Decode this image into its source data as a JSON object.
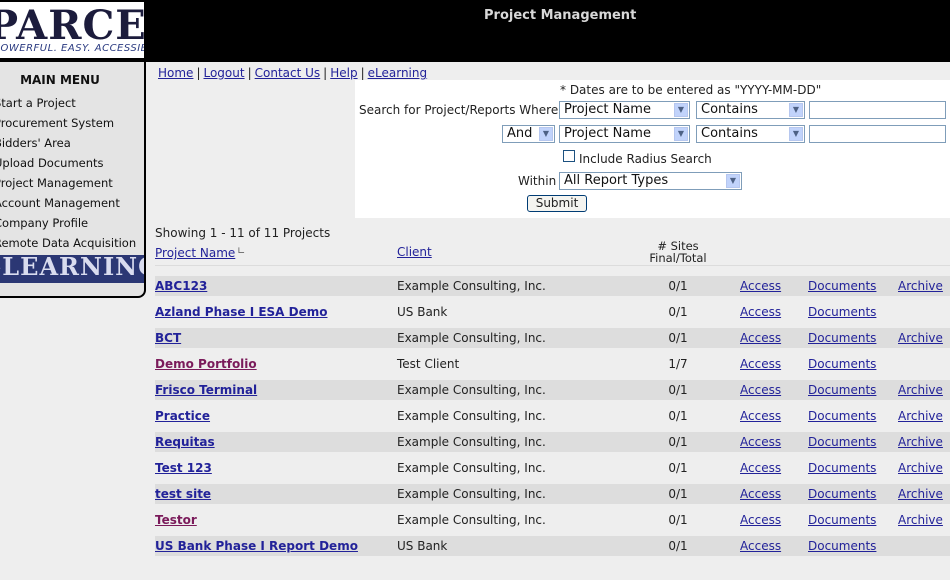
{
  "header": {
    "logo_text": "PARCEL",
    "logo_tagline": "POWERFUL. EASY. ACCESSIBLE.",
    "page_title": "Project Management"
  },
  "sidebar": {
    "title": "MAIN MENU",
    "items": [
      "Start a Project",
      "Procurement System",
      "Bidders' Area",
      "Upload Documents",
      "Project Management",
      "Account Management",
      "Company Profile",
      "Remote Data Acquisition"
    ],
    "banner": "eLEARNING"
  },
  "toplinks": [
    "Home",
    "Logout",
    "Contact Us",
    "Help",
    "eLearning"
  ],
  "search": {
    "date_note": "* Dates are to be entered as \"YYYY-MM-DD\"",
    "label_where": "Search for Project/Reports Where",
    "row1": {
      "field": "Project Name",
      "operator": "Contains",
      "value": ""
    },
    "row2": {
      "conjunction": "And",
      "field": "Project Name",
      "operator": "Contains",
      "value": ""
    },
    "radius_label": "Include Radius Search",
    "radius_checked": false,
    "within_label": "Within",
    "within_value": "All Report Types",
    "submit_label": "Submit"
  },
  "list": {
    "showing": "Showing 1 - 11 of 11 Projects",
    "headers": {
      "project_name": "Project Name",
      "client": "Client",
      "sites_line1": "# Sites",
      "sites_line2": "Final/Total"
    },
    "access_label": "Access",
    "documents_label": "Documents",
    "archive_label": "Archive",
    "rows": [
      {
        "name": "ABC123",
        "client": "Example Consulting, Inc.",
        "sites": "0/1",
        "archive": true,
        "visited": false
      },
      {
        "name": "Azland Phase I ESA Demo",
        "client": "US Bank",
        "sites": "0/1",
        "archive": false,
        "visited": false
      },
      {
        "name": "BCT",
        "client": "Example Consulting, Inc.",
        "sites": "0/1",
        "archive": true,
        "visited": false
      },
      {
        "name": "Demo Portfolio",
        "client": "Test Client",
        "sites": "1/7",
        "archive": false,
        "visited": true
      },
      {
        "name": "Frisco Terminal",
        "client": "Example Consulting, Inc.",
        "sites": "0/1",
        "archive": true,
        "visited": false
      },
      {
        "name": "Practice",
        "client": "Example Consulting, Inc.",
        "sites": "0/1",
        "archive": true,
        "visited": false
      },
      {
        "name": "Requitas",
        "client": "Example Consulting, Inc.",
        "sites": "0/1",
        "archive": true,
        "visited": false
      },
      {
        "name": "Test 123",
        "client": "Example Consulting, Inc.",
        "sites": "0/1",
        "archive": true,
        "visited": false
      },
      {
        "name": "test site",
        "client": "Example Consulting, Inc.",
        "sites": "0/1",
        "archive": true,
        "visited": false
      },
      {
        "name": "Testor",
        "client": "Example Consulting, Inc.",
        "sites": "0/1",
        "archive": true,
        "visited": true
      },
      {
        "name": "US Bank Phase I Report Demo",
        "client": "US Bank",
        "sites": "0/1",
        "archive": false,
        "visited": false
      }
    ]
  },
  "colors": {
    "link": "#222299",
    "visited_link": "#7a1a5a",
    "banner": "#2b3774",
    "row_stripe": "#dddddd"
  }
}
